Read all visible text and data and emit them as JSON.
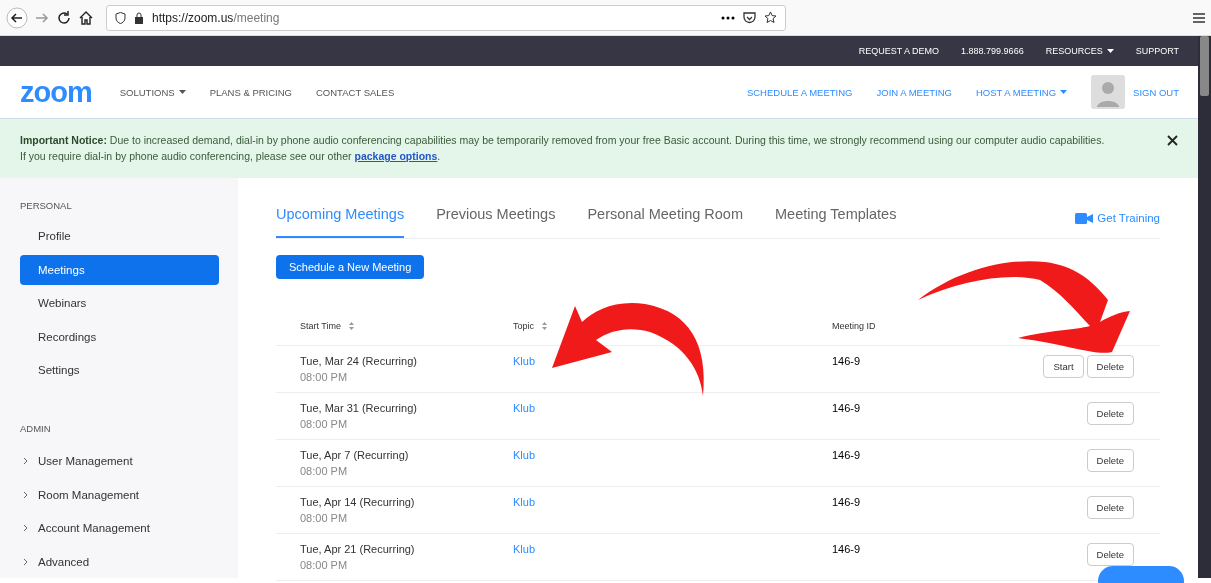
{
  "browser": {
    "url_host": "https://zoom.us",
    "url_path": "/meeting"
  },
  "top_bar": [
    {
      "label": "REQUEST A DEMO",
      "dropdown": false
    },
    {
      "label": "1.888.799.9666",
      "dropdown": false
    },
    {
      "label": "RESOURCES",
      "dropdown": true
    },
    {
      "label": "SUPPORT",
      "dropdown": false
    }
  ],
  "nav": {
    "logo": "zoom",
    "left": [
      {
        "label": "SOLUTIONS",
        "dropdown": true
      },
      {
        "label": "PLANS & PRICING",
        "dropdown": false
      },
      {
        "label": "CONTACT SALES",
        "dropdown": false
      }
    ],
    "right": [
      {
        "label": "SCHEDULE A MEETING",
        "dropdown": false
      },
      {
        "label": "JOIN A MEETING",
        "dropdown": false
      },
      {
        "label": "HOST A MEETING",
        "dropdown": true
      }
    ],
    "sign_out": "SIGN OUT"
  },
  "notice": {
    "text": "**Important Notice:** Due to increased demand, dial-in by phone audio conferencing capabilities may be temporarily removed from your free Basic account. During this time, we strongly recommend using our computer audio capabilities.",
    "text_2": "If you require dial-in by phone audio conferencing, please see our other",
    "link": "package options",
    "after_link": "."
  },
  "sidebar": [
    {
      "heading": "PERSONAL",
      "items": [
        {
          "label": "Profile",
          "selected": false,
          "kind": "link"
        },
        {
          "label": "Meetings",
          "selected": true,
          "kind": "link"
        },
        {
          "label": "Webinars",
          "selected": false,
          "kind": "link"
        },
        {
          "label": "Recordings",
          "selected": false,
          "kind": "link"
        },
        {
          "label": "Settings",
          "selected": false,
          "kind": "link"
        }
      ]
    },
    {
      "heading": "ADMIN",
      "items": [
        {
          "label": "User Management",
          "selected": false,
          "kind": "group"
        },
        {
          "label": "Room Management",
          "selected": false,
          "kind": "group"
        },
        {
          "label": "Account Management",
          "selected": false,
          "kind": "group"
        },
        {
          "label": "Advanced",
          "selected": false,
          "kind": "group"
        }
      ]
    }
  ],
  "tabs": [
    {
      "label": "Upcoming Meetings",
      "selected": true
    },
    {
      "label": "Previous Meetings",
      "selected": false
    },
    {
      "label": "Personal Meeting Room",
      "selected": false
    },
    {
      "label": "Meeting Templates",
      "selected": false
    }
  ],
  "get_training": "Get Training",
  "schedule_button": "Schedule a New Meeting",
  "table": {
    "columns": [
      {
        "label": "Start Time",
        "sortable": true
      },
      {
        "label": "Topic",
        "sortable": true
      },
      {
        "label": "Meeting ID",
        "sortable": false
      }
    ],
    "rows": [
      {
        "date": "Tue, Mar 24 (Recurring)",
        "time": "08:00 PM",
        "topic": "Klub",
        "meeting_id": "146-9",
        "actions": [
          "Start",
          "Delete"
        ]
      },
      {
        "date": "Tue, Mar 31 (Recurring)",
        "time": "08:00 PM",
        "topic": "Klub",
        "meeting_id": "146-9",
        "actions": [
          "Delete"
        ]
      },
      {
        "date": "Tue, Apr 7 (Recurring)",
        "time": "08:00 PM",
        "topic": "Klub",
        "meeting_id": "146-9",
        "actions": [
          "Delete"
        ]
      },
      {
        "date": "Tue, Apr 14 (Recurring)",
        "time": "08:00 PM",
        "topic": "Klub",
        "meeting_id": "146-9",
        "actions": [
          "Delete"
        ]
      },
      {
        "date": "Tue, Apr 21 (Recurring)",
        "time": "08:00 PM",
        "topic": "Klub",
        "meeting_id": "146-9",
        "actions": [
          "Delete"
        ]
      }
    ]
  }
}
